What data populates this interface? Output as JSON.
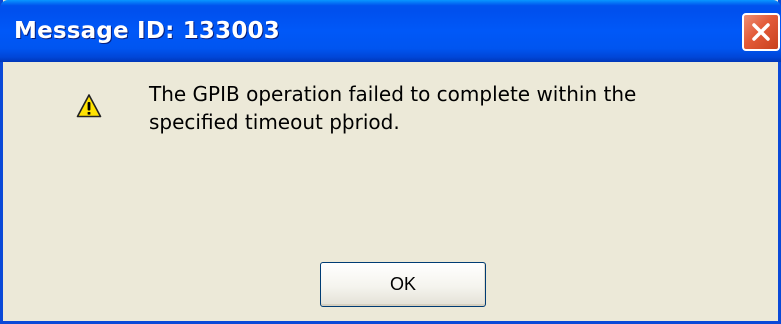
{
  "window": {
    "title": "Message ID: 133003",
    "close_icon": "close-icon"
  },
  "message": {
    "icon": "warning-icon",
    "line1": "The GPIB operation failed to complete within the",
    "line2": "specified timeout pþriod."
  },
  "buttons": {
    "ok_label": "OK"
  },
  "colors": {
    "title_bar": "#0058F8",
    "body_background": "#ECE9D8",
    "close_button": "#E35A38",
    "warning_yellow": "#FFE200"
  }
}
